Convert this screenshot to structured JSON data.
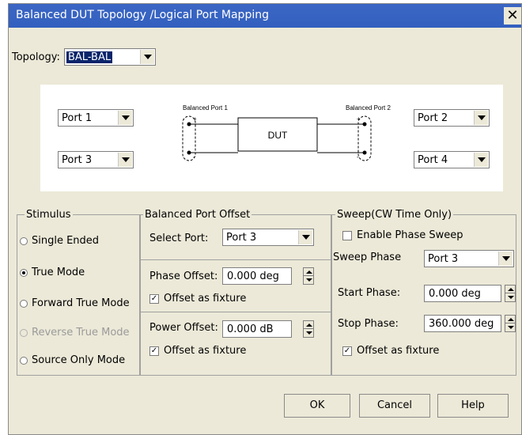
{
  "window": {
    "title": "Balanced DUT Topology /Logical Port Mapping",
    "close_glyph": "✕"
  },
  "topology": {
    "label": "Topology:",
    "value": "BAL-BAL"
  },
  "diagram": {
    "port_left_top": "Port 1",
    "port_left_bottom": "Port 3",
    "port_right_top": "Port 2",
    "port_right_bottom": "Port 4",
    "balanced_port_1": "Balanced Port 1",
    "balanced_port_2": "Balanced Port 2",
    "dut": "DUT",
    "plus": "+",
    "minus": "-"
  },
  "stimulus": {
    "legend": "Stimulus",
    "options": [
      {
        "label": "Single Ended",
        "selected": false,
        "enabled": true
      },
      {
        "label": "True Mode",
        "selected": true,
        "enabled": true
      },
      {
        "label": "Forward True Mode",
        "selected": false,
        "enabled": true
      },
      {
        "label": "Reverse True Mode",
        "selected": false,
        "enabled": false
      },
      {
        "label": "Source Only Mode",
        "selected": false,
        "enabled": true
      }
    ]
  },
  "balanced_offset": {
    "legend": "Balanced Port Offset",
    "select_port_label": "Select Port:",
    "select_port_value": "Port 3",
    "phase_offset_label": "Phase Offset:",
    "phase_offset_value": "0.000 deg",
    "phase_fixture_label": "Offset as fixture",
    "phase_fixture_checked": true,
    "power_offset_label": "Power Offset:",
    "power_offset_value": "0.000 dB",
    "power_fixture_label": "Offset as fixture",
    "power_fixture_checked": true
  },
  "sweep": {
    "legend": "Sweep(CW Time Only)",
    "enable_label": "Enable Phase Sweep",
    "enable_checked": false,
    "sweep_phase_label": "Sweep Phase",
    "sweep_phase_value": "Port 3",
    "start_label": "Start Phase:",
    "start_value": "0.000 deg",
    "stop_label": "Stop Phase:",
    "stop_value": "360.000 deg",
    "fixture_label": "Offset as fixture",
    "fixture_checked": true
  },
  "buttons": {
    "ok": "OK",
    "cancel": "Cancel",
    "help": "Help"
  },
  "check_glyph": "✓"
}
